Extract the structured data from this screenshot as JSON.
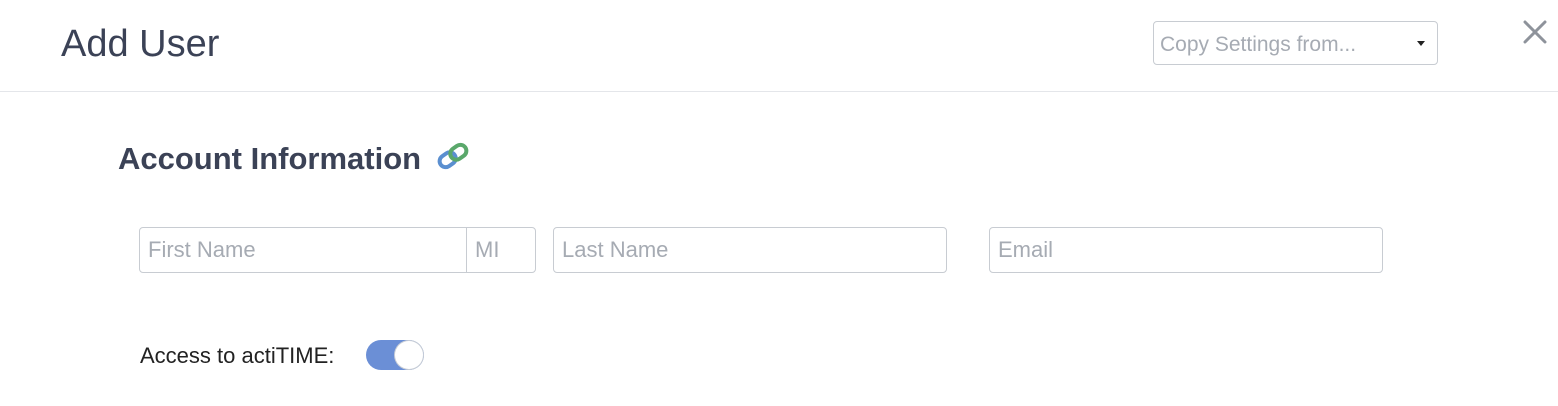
{
  "dialog": {
    "title": "Add User",
    "copy_settings": {
      "placeholder": "Copy Settings from..."
    },
    "close_icon": "close-icon"
  },
  "account": {
    "section_title": "Account Information",
    "link_icon": "link-icon",
    "first_name_placeholder": "First Name",
    "mi_placeholder": "MI",
    "last_name_placeholder": "Last Name",
    "email_placeholder": "Email",
    "first_name_value": "",
    "mi_value": "",
    "last_name_value": "",
    "email_value": ""
  },
  "access": {
    "label": "Access to actiTIME:",
    "enabled": true
  },
  "colors": {
    "title_text": "#3b4256",
    "toggle_on": "#6b8fd6",
    "border": "#c8ccd2",
    "placeholder": "#a6abb3"
  }
}
